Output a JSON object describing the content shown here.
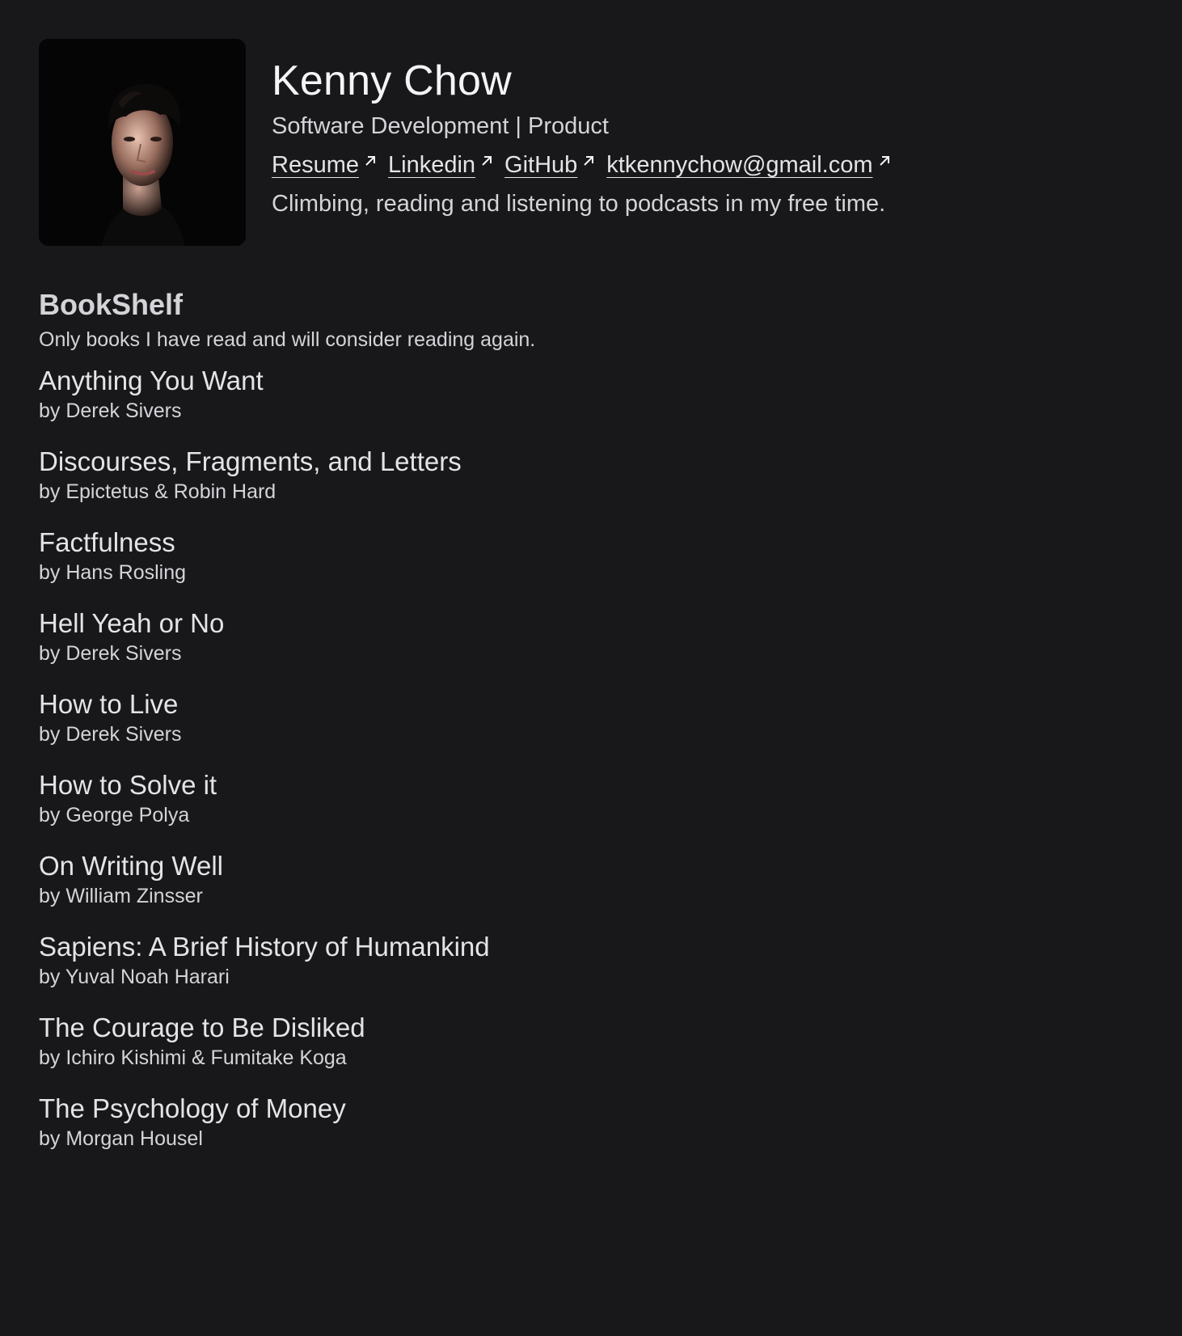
{
  "profile": {
    "name": "Kenny Chow",
    "role": "Software Development | Product",
    "bio": "Climbing, reading and listening to podcasts in my free time.",
    "avatar_icon": "portrait-photo",
    "links": [
      {
        "label": "Resume",
        "icon": "external-link-arrow-icon"
      },
      {
        "label": "Linkedin",
        "icon": "external-link-arrow-icon"
      },
      {
        "label": "GitHub",
        "icon": "external-link-arrow-icon"
      },
      {
        "label": "ktkennychow@gmail.com",
        "icon": "external-link-arrow-icon"
      }
    ]
  },
  "bookshelf": {
    "title": "BookShelf",
    "subtitle": "Only books I have read and will consider reading again.",
    "books": [
      {
        "title": "Anything You Want",
        "author": "by Derek Sivers"
      },
      {
        "title": "Discourses, Fragments, and Letters",
        "author": "by Epictetus & Robin Hard"
      },
      {
        "title": "Factfulness",
        "author": "by Hans Rosling"
      },
      {
        "title": "Hell Yeah or No",
        "author": "by Derek Sivers"
      },
      {
        "title": "How to Live",
        "author": "by Derek Sivers"
      },
      {
        "title": "How to Solve it",
        "author": "by George Polya"
      },
      {
        "title": "On Writing Well",
        "author": "by William Zinsser"
      },
      {
        "title": "Sapiens: A Brief History of Humankind",
        "author": "by Yuval Noah Harari"
      },
      {
        "title": "The Courage to Be Disliked",
        "author": "by Ichiro Kishimi & Fumitake Koga"
      },
      {
        "title": "The Psychology of Money",
        "author": "by Morgan Housel"
      }
    ]
  },
  "colors": {
    "background": "#18181b",
    "text": "#e4e4e7",
    "muted_text": "#d4d4d8"
  }
}
